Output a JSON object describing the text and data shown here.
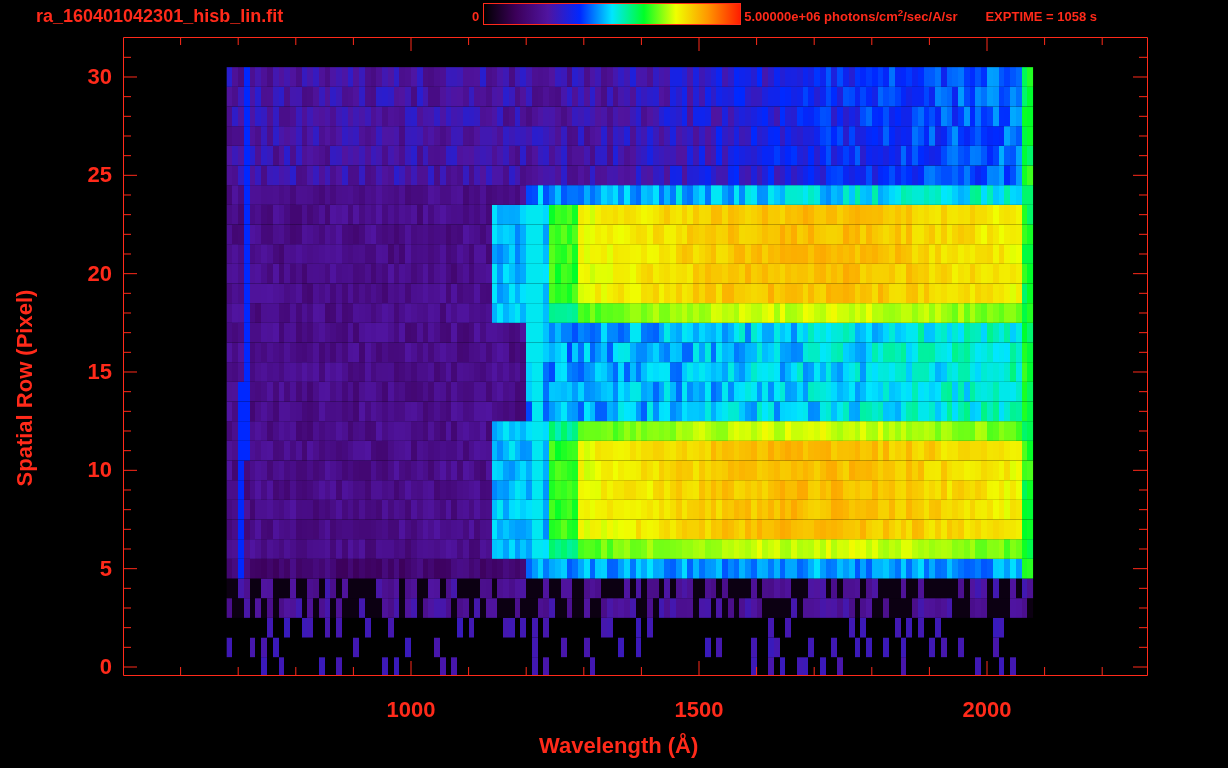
{
  "title": "ra_160401042301_hisb_lin.fit",
  "colorbar": {
    "min_label": "0",
    "max_label": "5.00000e+06 photons/cm$^{2}$/sec/A/sr"
  },
  "exptime": "EXPTIME = 1058 s",
  "y_axis": {
    "label": "Spatial Row (Pixel)",
    "ticks": [
      "30",
      "25",
      "20",
      "15",
      "10",
      "5",
      "0"
    ]
  },
  "x_axis": {
    "label": "Wavelength (Å)",
    "ticks": [
      "1000",
      "1500",
      "2000"
    ]
  }
}
